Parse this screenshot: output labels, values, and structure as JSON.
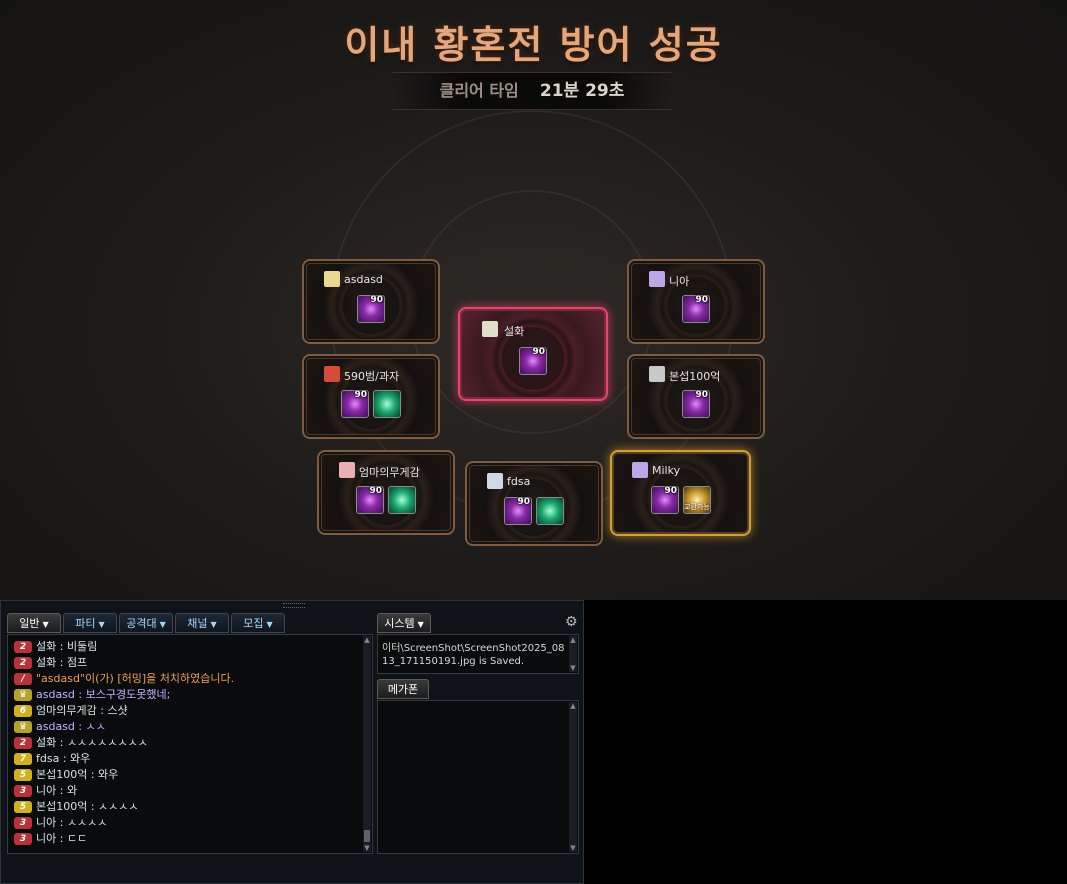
{
  "result": {
    "title": "이내 황혼전 방어 성공",
    "clear_label": "클리어 타임",
    "clear_time": "21분 29초"
  },
  "party": [
    {
      "name": "asdasd",
      "icon": "leader-badge-icon",
      "items": [
        {
          "level": "90",
          "type": "purple"
        }
      ]
    },
    {
      "name": "니아",
      "icon": "mage-class-icon",
      "items": [
        {
          "level": "90",
          "type": "purple"
        }
      ]
    },
    {
      "name": "설화",
      "icon": "scroll-class-icon",
      "items": [
        {
          "level": "90",
          "type": "purple"
        }
      ],
      "highlight": "red"
    },
    {
      "name": "590범/과자",
      "icon": "warrior-class-icon",
      "items": [
        {
          "level": "90",
          "type": "purple"
        },
        {
          "level": "",
          "type": "green"
        }
      ]
    },
    {
      "name": "본섭100억",
      "icon": "assassin-class-icon",
      "items": [
        {
          "level": "90",
          "type": "purple"
        }
      ]
    },
    {
      "name": "엄마의무게감",
      "icon": "priest-class-icon",
      "items": [
        {
          "level": "90",
          "type": "purple"
        },
        {
          "level": "",
          "type": "green"
        }
      ]
    },
    {
      "name": "fdsa",
      "icon": "archer-class-icon",
      "items": [
        {
          "level": "90",
          "type": "purple"
        },
        {
          "level": "",
          "type": "green"
        }
      ]
    },
    {
      "name": "Milky",
      "icon": "mage-class-icon",
      "items": [
        {
          "level": "90",
          "type": "purple"
        },
        {
          "level": "",
          "type": "gold",
          "tag": "교환가능"
        }
      ],
      "highlight": "gold"
    }
  ],
  "chat": {
    "tabs": [
      "일반",
      "파티",
      "공격대",
      "채널",
      "모집"
    ],
    "lines": [
      {
        "badge": "2",
        "badge_color": "#b8323a",
        "text": "설화 : 비둘림",
        "color": "#e0e0e0"
      },
      {
        "badge": "2",
        "badge_color": "#b8323a",
        "text": "설화 : 점프",
        "color": "#e0e0e0"
      },
      {
        "badge": "/",
        "badge_color": "#b8323a",
        "text": "\"asdasd\"이(가) [허밍]을 처치하였습니다.",
        "color": "#f0a050"
      },
      {
        "badge": "♛",
        "badge_color": "#b8a030",
        "text": "asdasd : 보스구경도못했네;",
        "color": "#c8b0ff"
      },
      {
        "badge": "6",
        "badge_color": "#d0b020",
        "text": "엄마의무게감 : 스샷",
        "color": "#e0e0e0"
      },
      {
        "badge": "♛",
        "badge_color": "#b8a030",
        "text": "asdasd : ㅅㅅ",
        "color": "#c8b0ff"
      },
      {
        "badge": "2",
        "badge_color": "#b8323a",
        "text": "설화 : ㅅㅅㅅㅅㅅㅅㅅㅅ",
        "color": "#e0e0e0"
      },
      {
        "badge": "7",
        "badge_color": "#d0b020",
        "text": "fdsa : 와우",
        "color": "#e0e0e0"
      },
      {
        "badge": "5",
        "badge_color": "#d0b020",
        "text": "본섭100억 : 와우",
        "color": "#e0e0e0"
      },
      {
        "badge": "3",
        "badge_color": "#b8323a",
        "text": "니아 : 와",
        "color": "#e0e0e0"
      },
      {
        "badge": "5",
        "badge_color": "#d0b020",
        "text": "본섭100억 : ㅅㅅㅅㅅ",
        "color": "#e0e0e0"
      },
      {
        "badge": "3",
        "badge_color": "#b8323a",
        "text": "니아 : ㅅㅅㅅㅅ",
        "color": "#e0e0e0"
      },
      {
        "badge": "3",
        "badge_color": "#b8323a",
        "text": "니아 : ㄷㄷ",
        "color": "#e0e0e0"
      }
    ],
    "system_tab": "시스템",
    "system_lines": [
      "이터\\ScreenShot\\ScreenShot2025_08",
      "13_171150191.jpg is Saved."
    ],
    "megaphone_tab": "메가폰"
  }
}
